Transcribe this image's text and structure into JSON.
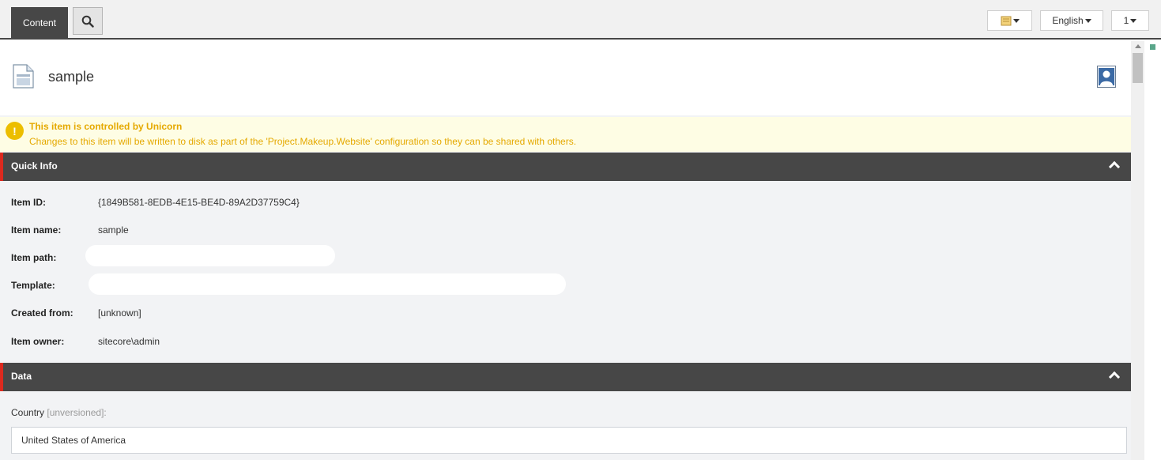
{
  "topbar": {
    "content_tab": "Content",
    "language": "English",
    "version": "1",
    "icons": {
      "search": "search-icon",
      "book": "book-icon"
    }
  },
  "item": {
    "title": "sample",
    "icons": {
      "document": "document-icon",
      "user": "user-icon"
    }
  },
  "warning": {
    "title": "This item is controlled by Unicorn",
    "message": "Changes to this item will be written to disk as part of the 'Project.Makeup.Website' configuration so they can be shared with others."
  },
  "quick_info": {
    "title": "Quick Info",
    "rows": [
      {
        "label": "Item ID:",
        "value": "{1849B581-8EDB-4E15-BE4D-89A2D37759C4}"
      },
      {
        "label": "Item name:",
        "value": "sample"
      },
      {
        "label": "Item path:",
        "value": ""
      },
      {
        "label": "Template:",
        "value": ""
      },
      {
        "label": "Created from:",
        "value": "[unknown]"
      },
      {
        "label": "Item owner:",
        "value": "sitecore\\admin"
      }
    ]
  },
  "data_section": {
    "title": "Data",
    "country_label": "Country",
    "country_tag": "[unversioned]",
    "country_suffix": ":",
    "country_value": "United States of America"
  },
  "colors": {
    "accent_red": "#dc291e",
    "section_bar": "#474747",
    "warning_text": "#e5a900",
    "warning_bg": "#fefde4"
  }
}
